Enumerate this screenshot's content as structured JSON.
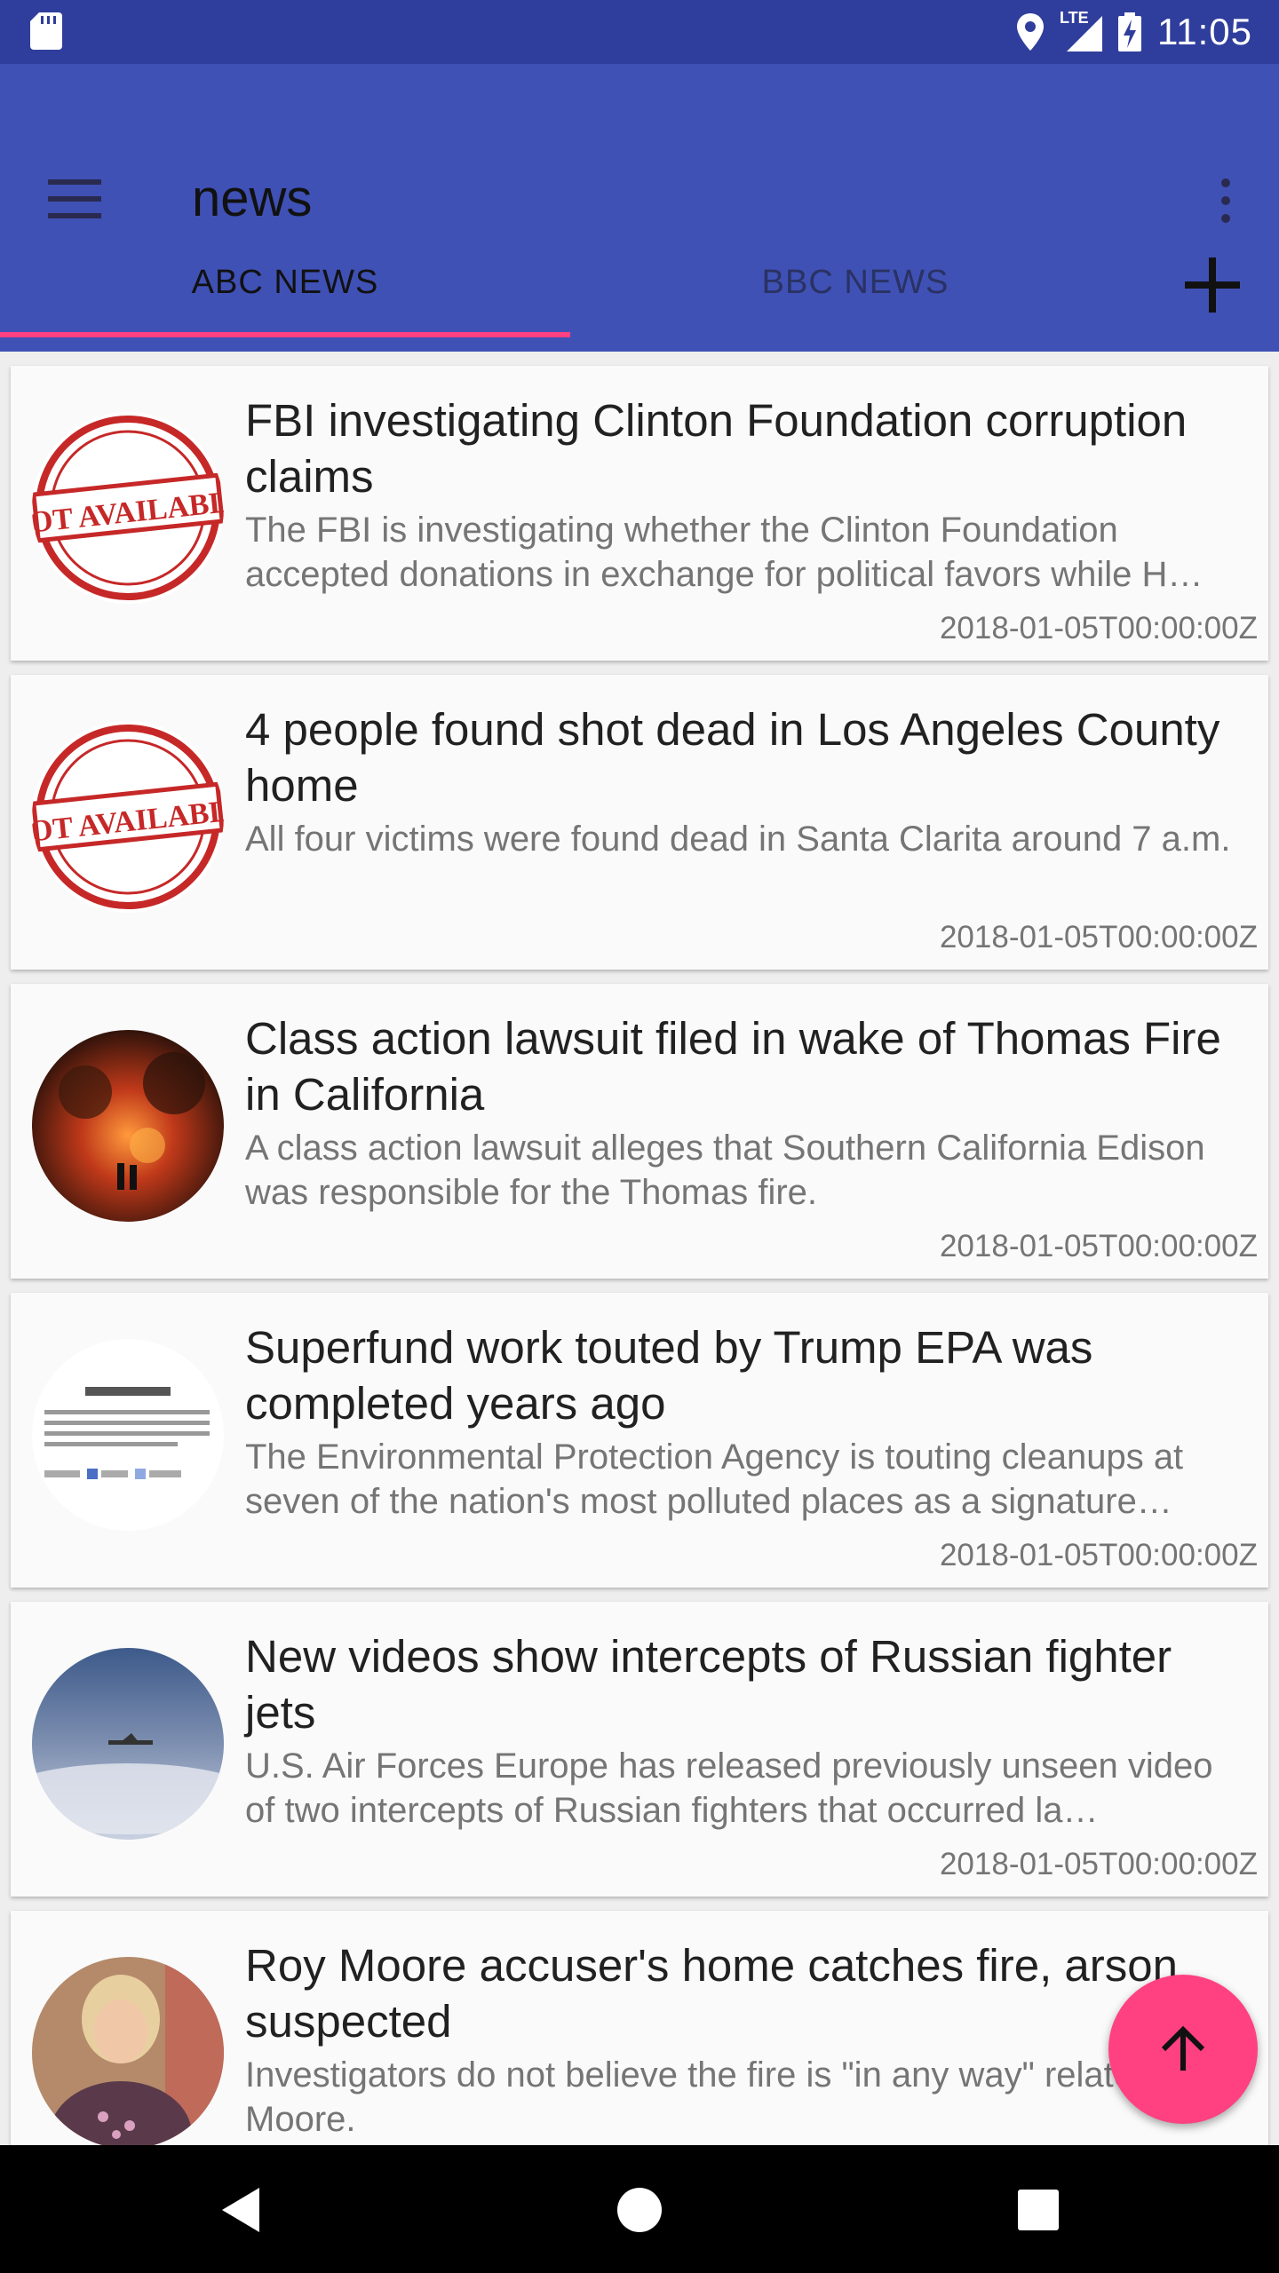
{
  "status_bar": {
    "time": "11:05",
    "network": "LTE",
    "icons": [
      "sd-card-icon",
      "location-icon",
      "signal-icon",
      "battery-charging-icon"
    ]
  },
  "app_bar": {
    "title": "news",
    "menu_icon": "hamburger-menu-icon",
    "overflow_icon": "more-vert-icon"
  },
  "tabs": [
    {
      "label": "ABC NEWS",
      "selected": true
    },
    {
      "label": "BBC NEWS",
      "selected": false
    }
  ],
  "add_tab_icon": "plus-icon",
  "colors": {
    "primary": "#3f51b5",
    "primary_dark": "#2f3e9c",
    "accent": "#ff4081"
  },
  "articles": [
    {
      "title": "FBI investigating Clinton Foundation corruption claims",
      "description": "The FBI is investigating whether the Clinton Foundation accepted donations in exchange for political favors while H…",
      "date": "2018-01-05T00:00:00Z",
      "thumbnail": "not-available-stamp"
    },
    {
      "title": "4 people found shot dead in Los Angeles County home",
      "description": "All four victims were found dead in Santa Clarita around 7 a.m.",
      "date": "2018-01-05T00:00:00Z",
      "thumbnail": "not-available-stamp"
    },
    {
      "title": "Class action lawsuit filed in wake of Thomas Fire in California",
      "description": "A class action lawsuit alleges that Southern California Edison was responsible for the Thomas fire.",
      "date": "2018-01-05T00:00:00Z",
      "thumbnail": "wildfire-photo"
    },
    {
      "title": "Superfund work touted by Trump EPA was completed years ago",
      "description": "The Environmental Protection Agency is touting cleanups at seven of the nation's most polluted places as a signature…",
      "date": "2018-01-05T00:00:00Z",
      "thumbnail": "toxic-site-cleanup-chart"
    },
    {
      "title": "New videos show intercepts of Russian fighter jets",
      "description": "U.S. Air Forces Europe has released previously unseen video of two intercepts of Russian fighters that occurred la…",
      "date": "2018-01-05T00:00:00Z",
      "thumbnail": "jet-over-clouds-photo"
    },
    {
      "title": "Roy Moore accuser's home catches fire, arson suspected",
      "description": "Investigators do not believe the fire is \"in any way\" related to Moore.",
      "date": "",
      "thumbnail": "woman-portrait-photo"
    }
  ],
  "fab": {
    "icon": "arrow-up-icon"
  },
  "nav_bar": {
    "icons": [
      "back-icon",
      "home-icon",
      "recents-icon"
    ]
  }
}
